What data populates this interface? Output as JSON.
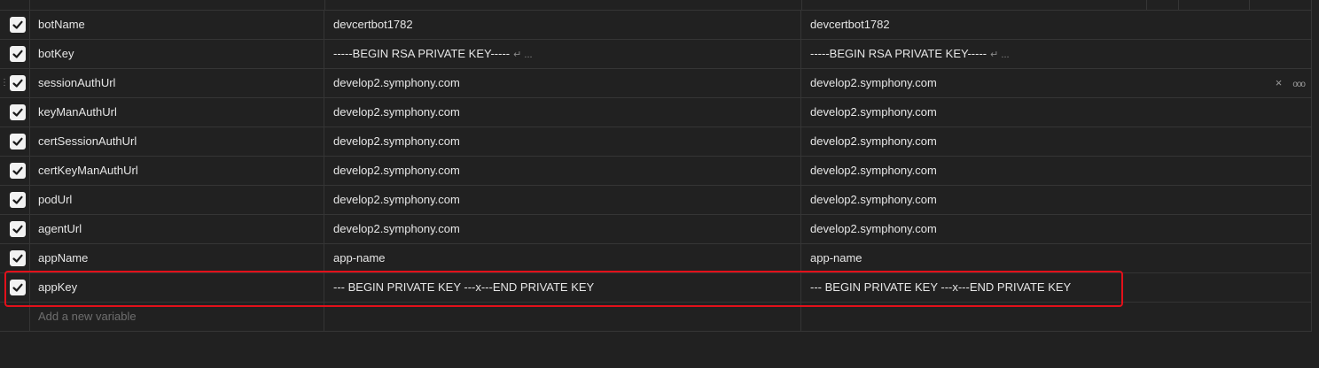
{
  "variables": [
    {
      "key": "botName",
      "initial_value": "devcertbot1782",
      "initial_suffix": "",
      "current_value": "devcertbot1782",
      "current_suffix": "",
      "enabled": true
    },
    {
      "key": "botKey",
      "initial_value": "-----BEGIN RSA PRIVATE KEY-----",
      "initial_suffix": "↵ ...",
      "current_value": "-----BEGIN RSA PRIVATE KEY-----",
      "current_suffix": "↵ ...",
      "enabled": true
    },
    {
      "key": "sessionAuthUrl",
      "initial_value": "develop2.symphony.com",
      "initial_suffix": "",
      "current_value": "develop2.symphony.com",
      "current_suffix": "",
      "enabled": true
    },
    {
      "key": "keyManAuthUrl",
      "initial_value": "develop2.symphony.com",
      "initial_suffix": "",
      "current_value": "develop2.symphony.com",
      "current_suffix": "",
      "enabled": true
    },
    {
      "key": "certSessionAuthUrl",
      "initial_value": "develop2.symphony.com",
      "initial_suffix": "",
      "current_value": "develop2.symphony.com",
      "current_suffix": "",
      "enabled": true
    },
    {
      "key": "certKeyManAuthUrl",
      "initial_value": "develop2.symphony.com",
      "initial_suffix": "",
      "current_value": "develop2.symphony.com",
      "current_suffix": "",
      "enabled": true
    },
    {
      "key": "podUrl",
      "initial_value": "develop2.symphony.com",
      "initial_suffix": "",
      "current_value": "develop2.symphony.com",
      "current_suffix": "",
      "enabled": true
    },
    {
      "key": "agentUrl",
      "initial_value": "develop2.symphony.com",
      "initial_suffix": "",
      "current_value": "develop2.symphony.com",
      "current_suffix": "",
      "enabled": true
    },
    {
      "key": "appName",
      "initial_value": "app-name",
      "initial_suffix": "",
      "current_value": "app-name",
      "current_suffix": "",
      "enabled": true
    },
    {
      "key": "appKey",
      "initial_value": "--- BEGIN PRIVATE KEY ---x---END PRIVATE KEY",
      "initial_suffix": "",
      "current_value": "--- BEGIN PRIVATE KEY ---x---END PRIVATE KEY",
      "current_suffix": "",
      "enabled": true
    }
  ],
  "new_row": {
    "placeholder": "Add a new variable"
  },
  "hover_row_actions": {
    "delete_icon": "close-icon",
    "delete_glyph": "×",
    "more_icon": "more-options-icon",
    "more_glyph": "ooo"
  },
  "colors": {
    "background": "#212121",
    "grid": "#353535",
    "text": "#e6e6e6",
    "highlight": "#e3101a",
    "checkbox": "#f2f2f2"
  }
}
